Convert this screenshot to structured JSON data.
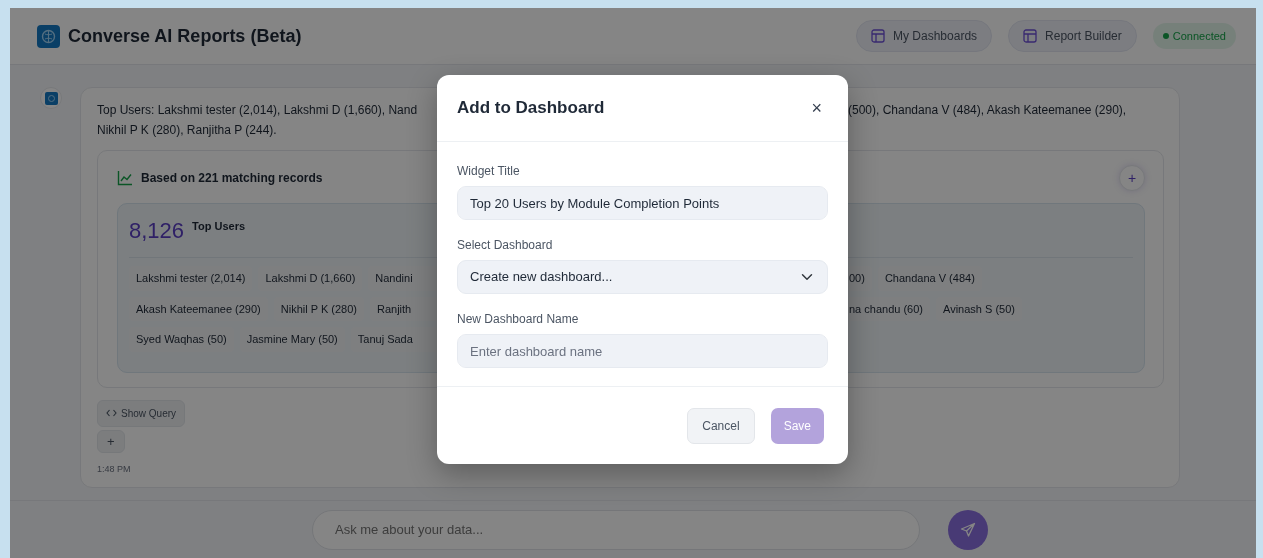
{
  "header": {
    "title": "Converse AI Reports (Beta)",
    "buttons": [
      {
        "label": "My Dashboards"
      },
      {
        "label": "Report Builder"
      }
    ],
    "status": {
      "label": "Connected",
      "online": true
    }
  },
  "message": {
    "lines": [
      [
        "Top Users: Lakshmi tester (2,014), Lakshmi D (1,660), Nand",
        "(500), Chandana V (484), Akash Kateemanee (290),"
      ],
      [
        "Nikhil P K (280), Ranjitha P (244)."
      ]
    ],
    "time": "1:48 PM"
  },
  "result": {
    "heading": "Based on 221 matching records",
    "add_symbol": "+",
    "stat_value": "8,126",
    "stat_label": "Top Users",
    "chip_rows": [
      {
        "left": [
          "Lakshmi tester (2,014)",
          "Lakshmi D (1,660)",
          "Nandini"
        ],
        "right": [
          "00)",
          "Chandana V (484)"
        ]
      },
      {
        "left": [
          "Akash Kateemanee (290)",
          "Nikhil P K (280)",
          "Ranjith"
        ],
        "right": [
          "na chandu (60)",
          "Avinash S (50)"
        ]
      },
      {
        "left": [
          "Syed Waqhas (50)",
          "Jasmine Mary (50)",
          "Tanuj Sada"
        ],
        "right": []
      }
    ],
    "show_query": "Show Query",
    "plus": "+"
  },
  "chat_input": {
    "placeholder": "Ask me about your data..."
  },
  "modal": {
    "title": "Add to Dashboard",
    "close": "×",
    "fields": [
      {
        "kind": "text",
        "label": "Widget Title",
        "value": "Top 20 Users by Module Completion Points"
      },
      {
        "kind": "select",
        "label": "Select Dashboard",
        "value": "Create new dashboard..."
      },
      {
        "kind": "text",
        "label": "New Dashboard Name",
        "placeholder": "Enter dashboard name"
      }
    ],
    "buttons": [
      {
        "label": "Cancel",
        "kind": "secondary",
        "disabled": false
      },
      {
        "label": "Save",
        "kind": "primary",
        "disabled": true
      }
    ]
  }
}
